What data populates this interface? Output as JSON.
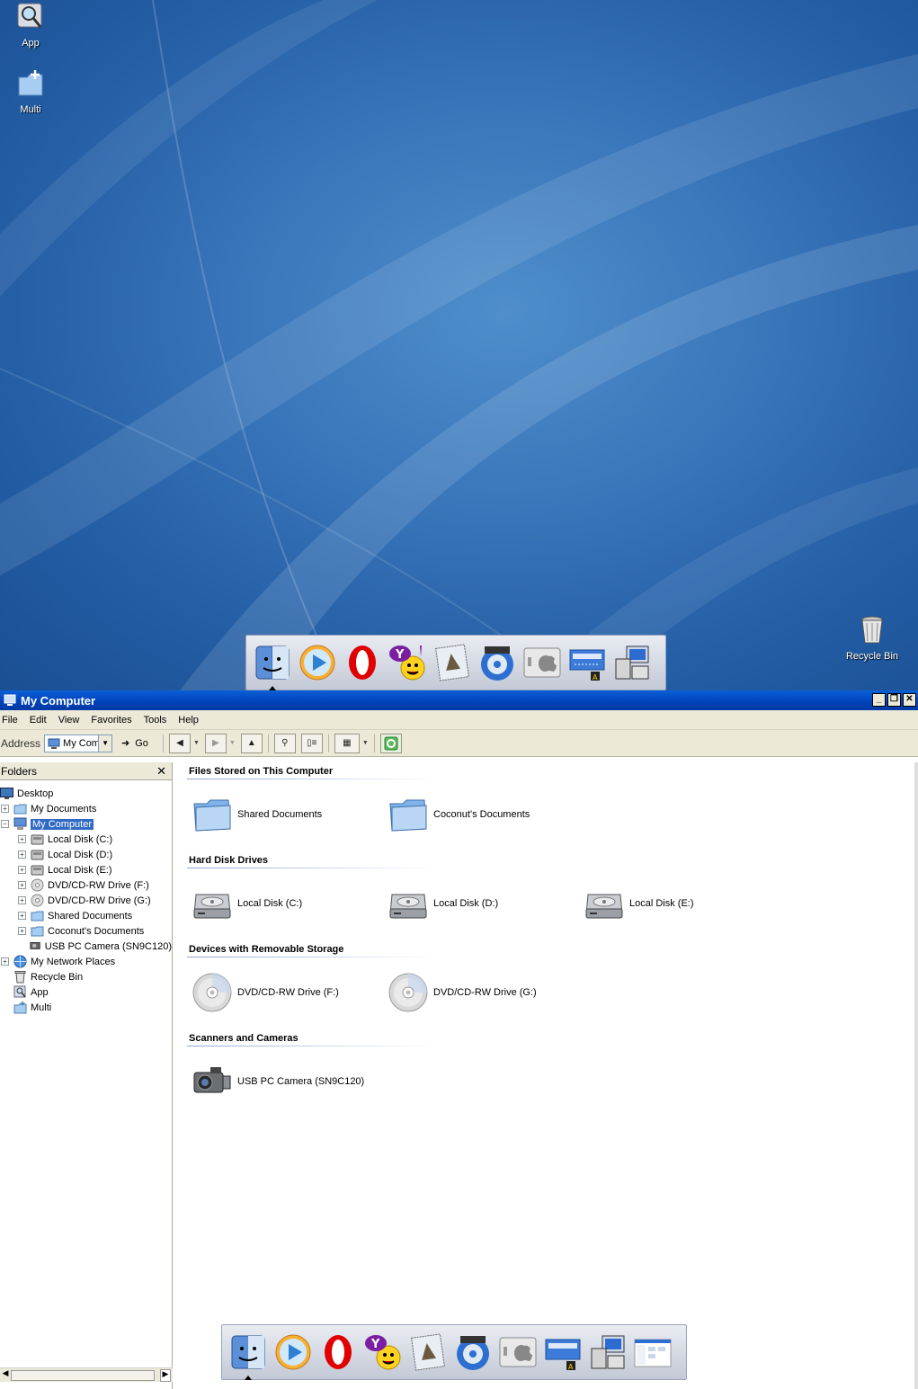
{
  "desktop": {
    "icons": [
      {
        "label": "App",
        "icon": "magnifier-app-icon"
      },
      {
        "label": "Multi",
        "icon": "folder-plus-icon"
      },
      {
        "label": "Recycle Bin",
        "icon": "recycle-bin-icon"
      }
    ],
    "dock_items": [
      "finder-icon",
      "media-player-icon",
      "opera-icon",
      "yahoo-messenger-icon",
      "mail-stamp-icon",
      "dvd-player-icon",
      "apple-system-icon",
      "network-adapter-icon",
      "my-computer-icon"
    ]
  },
  "window": {
    "title": "My Computer",
    "menu": [
      "File",
      "Edit",
      "View",
      "Favorites",
      "Tools",
      "Help"
    ],
    "address_label": "Address",
    "address_value": "My Com",
    "go_label": "Go",
    "folders_header": "Folders",
    "tree": [
      {
        "label": "Desktop",
        "depth": 0,
        "expander": "",
        "icon": "desktop-icon"
      },
      {
        "label": "My Documents",
        "depth": 1,
        "expander": "+",
        "icon": "folder-icon"
      },
      {
        "label": "My Computer",
        "depth": 1,
        "expander": "-",
        "icon": "computer-icon",
        "selected": true
      },
      {
        "label": "Local Disk (C:)",
        "depth": 2,
        "expander": "+",
        "icon": "disk-icon"
      },
      {
        "label": "Local Disk (D:)",
        "depth": 2,
        "expander": "+",
        "icon": "disk-icon"
      },
      {
        "label": "Local Disk (E:)",
        "depth": 2,
        "expander": "+",
        "icon": "disk-icon"
      },
      {
        "label": "DVD/CD-RW Drive (F:)",
        "depth": 2,
        "expander": "+",
        "icon": "cd-icon"
      },
      {
        "label": "DVD/CD-RW Drive (G:)",
        "depth": 2,
        "expander": "+",
        "icon": "cd-icon"
      },
      {
        "label": "Shared Documents",
        "depth": 2,
        "expander": "+",
        "icon": "folder-icon"
      },
      {
        "label": "Coconut's Documents",
        "depth": 2,
        "expander": "+",
        "icon": "folder-icon"
      },
      {
        "label": "USB PC Camera (SN9C120)",
        "depth": 2,
        "expander": "",
        "icon": "camera-icon"
      },
      {
        "label": "My Network Places",
        "depth": 1,
        "expander": "+",
        "icon": "network-icon"
      },
      {
        "label": "Recycle Bin",
        "depth": 1,
        "expander": "",
        "icon": "recycle-bin-icon"
      },
      {
        "label": "App",
        "depth": 1,
        "expander": "",
        "icon": "app-icon"
      },
      {
        "label": "Multi",
        "depth": 1,
        "expander": "",
        "icon": "folder-plus-icon"
      }
    ],
    "groups": [
      {
        "title": "Files Stored on This Computer",
        "items": [
          {
            "label": "Shared Documents",
            "icon": "folder-icon"
          },
          {
            "label": "Coconut's Documents",
            "icon": "folder-icon"
          }
        ]
      },
      {
        "title": "Hard Disk Drives",
        "items": [
          {
            "label": "Local Disk (C:)",
            "icon": "hard-disk-icon"
          },
          {
            "label": "Local Disk (D:)",
            "icon": "hard-disk-icon"
          },
          {
            "label": "Local Disk (E:)",
            "icon": "hard-disk-icon"
          }
        ]
      },
      {
        "title": "Devices with Removable Storage",
        "items": [
          {
            "label": "DVD/CD-RW Drive (F:)",
            "icon": "cd-icon"
          },
          {
            "label": "DVD/CD-RW Drive (G:)",
            "icon": "cd-icon"
          }
        ]
      },
      {
        "title": "Scanners and Cameras",
        "items": [
          {
            "label": "USB PC Camera (SN9C120)",
            "icon": "camera-icon"
          }
        ]
      }
    ],
    "dock_items": [
      "finder-icon",
      "media-player-icon",
      "opera-icon",
      "yahoo-messenger-icon",
      "mail-stamp-icon",
      "dvd-player-icon",
      "apple-system-icon",
      "network-adapter-icon",
      "my-computer-icon",
      "window-thumbnail-icon"
    ]
  }
}
